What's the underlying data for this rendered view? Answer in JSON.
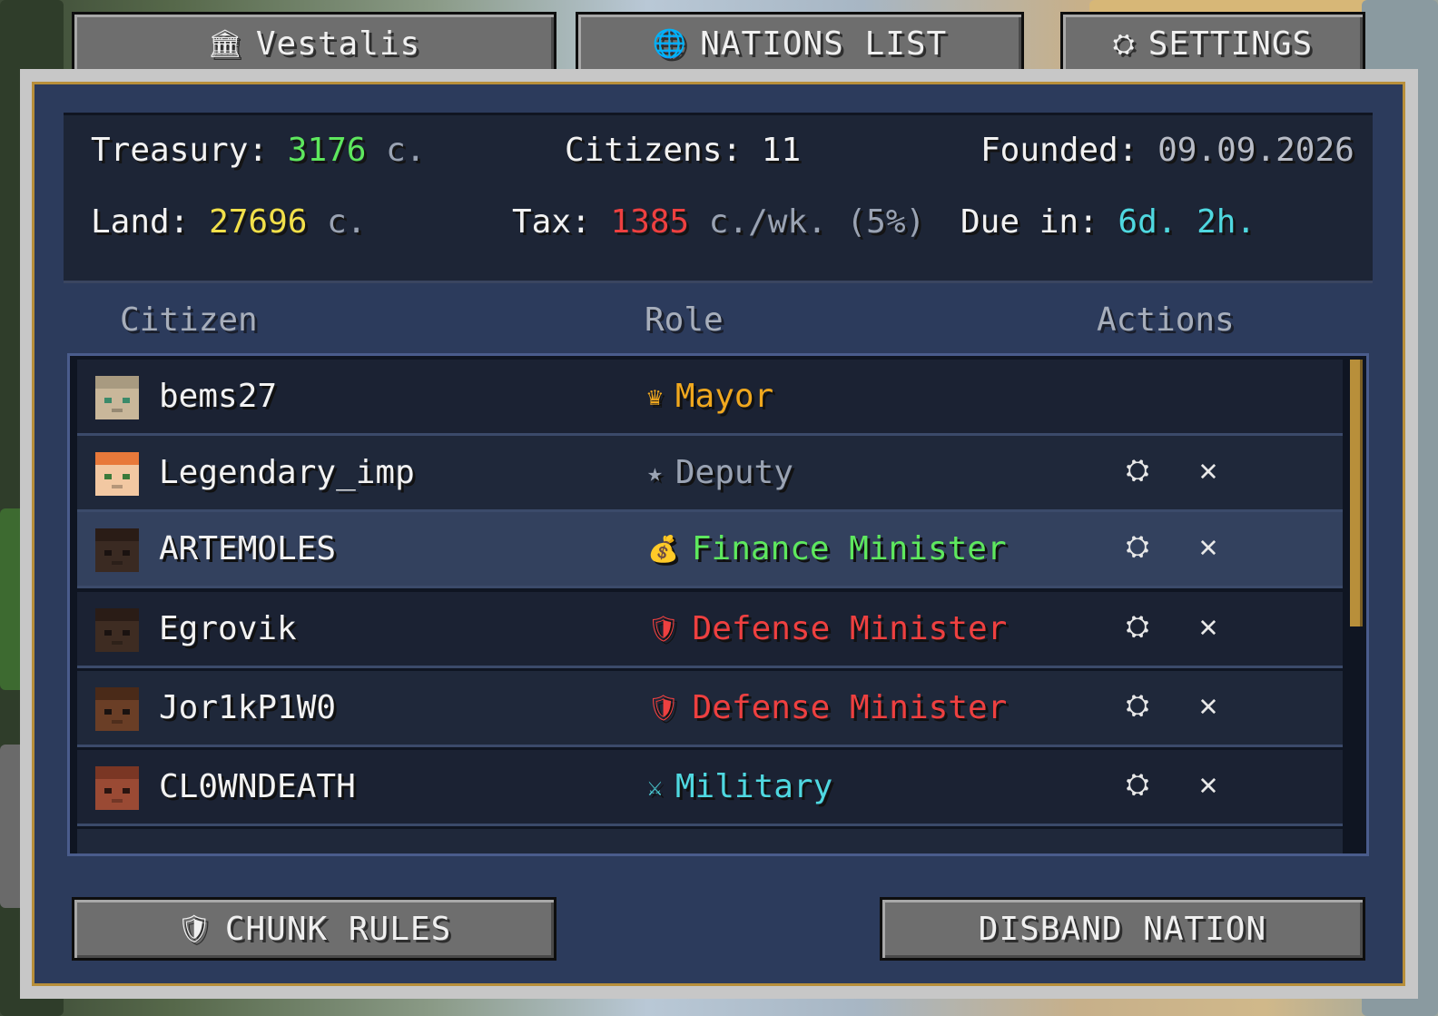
{
  "top_buttons": {
    "nation": {
      "icon": "🏛",
      "label": "Vestalis"
    },
    "nations_list": {
      "icon": "🌐",
      "label": "NATIONS LIST"
    },
    "settings": {
      "icon": "⛭",
      "label": "SETTINGS"
    }
  },
  "stats": {
    "treasury_label": "Treasury:",
    "treasury_value": "3176",
    "treasury_unit": "c.",
    "citizens_label": "Citizens:",
    "citizens_value": "11",
    "founded_label": "Founded:",
    "founded_value": "09.09.2026",
    "land_label": "Land:",
    "land_value": "27696",
    "land_unit": "c.",
    "tax_label": "Tax:",
    "tax_value": "1385",
    "tax_unit": "c./wk. (5%)",
    "due_label": "Due in:",
    "due_value": "6d. 2h."
  },
  "columns": {
    "citizen": "Citizen",
    "role": "Role",
    "actions": "Actions"
  },
  "citizens": [
    {
      "name": "bems27",
      "role": "Mayor",
      "role_icon": "♛",
      "role_color": "#f0a81e",
      "skin": "#c9b79a",
      "hair": "#a89a80",
      "eyes": "#3b8a6a"
    },
    {
      "name": "Legendary_imp",
      "role": "Deputy",
      "role_icon": "★",
      "role_color": "#9aa3b3",
      "skin": "#f2c8a2",
      "hair": "#e8793a",
      "eyes": "#3b7a3a"
    },
    {
      "name": "ARTEMOLES",
      "role": "Finance Minister",
      "role_icon": "💰",
      "role_color": "#5ee85e",
      "skin": "#3a2a22",
      "hair": "#2a1c16",
      "eyes": "#1a1210"
    },
    {
      "name": "Egrovik",
      "role": "Defense Minister",
      "role_icon": "🛡",
      "role_color": "#ee4040",
      "skin": "#3e2c22",
      "hair": "#2a1c16",
      "eyes": "#1a1210"
    },
    {
      "name": "Jor1kP1W0",
      "role": "Defense Minister",
      "role_icon": "🛡",
      "role_color": "#ee4040",
      "skin": "#6a3e26",
      "hair": "#4a2a18",
      "eyes": "#1a1210"
    },
    {
      "name": "CL0WNDEATH",
      "role": "Military",
      "role_icon": "⚔",
      "role_color": "#4fd8e0",
      "skin": "#9a4a34",
      "hair": "#7a3624",
      "eyes": "#2a1410"
    }
  ],
  "bottom_buttons": {
    "chunk_rules": {
      "icon": "🛡",
      "label": "CHUNK RULES"
    },
    "disband": {
      "label": "DISBAND NATION"
    }
  },
  "colors": {
    "treasury": "#5ee85e",
    "land": "#f2e04a",
    "tax": "#ee4040",
    "due": "#4fd8e0",
    "founded": "#b8bcc6",
    "accent_border": "#b88f3a"
  },
  "icons": {
    "gear": "⛭",
    "close": "✕"
  }
}
